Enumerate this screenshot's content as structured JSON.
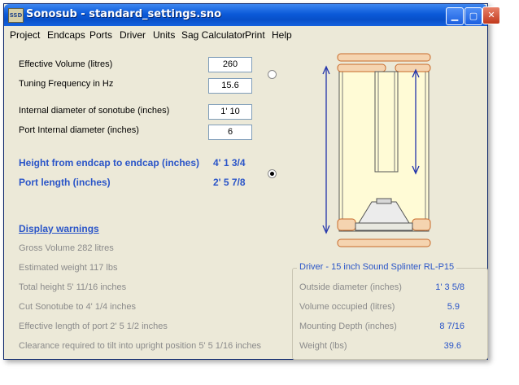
{
  "window": {
    "title": "Sonosub - standard_settings.sno",
    "icon_text": "SSD",
    "min_glyph": "▁",
    "max_glyph": "▢",
    "close_glyph": "✕"
  },
  "menu": [
    "Project",
    "Endcaps",
    "Ports",
    "Driver",
    "Units",
    "Sag Calculator",
    "Print",
    "Help"
  ],
  "inputs": {
    "effective_volume": {
      "label": "Effective Volume (litres)",
      "value": "260"
    },
    "tuning_frequency": {
      "label": "Tuning Frequency in Hz",
      "value": "15.6"
    },
    "internal_diameter": {
      "label": "Internal diameter of sonotube (inches)",
      "value": "1' 10"
    },
    "port_diameter": {
      "label": "Port Internal diameter (inches)",
      "value": "6"
    }
  },
  "results": {
    "height": {
      "label": "Height from endcap to endcap (inches)",
      "value": "4' 1 3/4"
    },
    "port_length": {
      "label": "Port length (inches)",
      "value": "2' 5 7/8"
    }
  },
  "warnings": {
    "title": "Display warnings",
    "items": [
      "Gross Volume  282 litres",
      "Estimated weight  117 lbs",
      "Total height 5' 11/16 inches",
      "Cut Sonotube to  4' 1/4 inches",
      "Effective length of port 2' 5 1/2 inches",
      "Clearance required to tilt into upright position 5' 5 1/16 inches"
    ]
  },
  "driver": {
    "title": "Driver - 15 inch Sound Splinter RL-P15",
    "rows": [
      {
        "label": "Outside diameter (inches)",
        "value": "1' 3 5/8"
      },
      {
        "label": "Volume occupied (litres)",
        "value": "5.9"
      },
      {
        "label": "Mounting Depth (inches)",
        "value": "8 7/16"
      },
      {
        "label": "Weight (lbs)",
        "value": "39.6"
      }
    ]
  },
  "colors": {
    "accent": "#2a55c8",
    "tube_fill": "#fffbd6",
    "cap_fill": "#f5d4b0",
    "cap_stroke": "#c86a2a"
  }
}
